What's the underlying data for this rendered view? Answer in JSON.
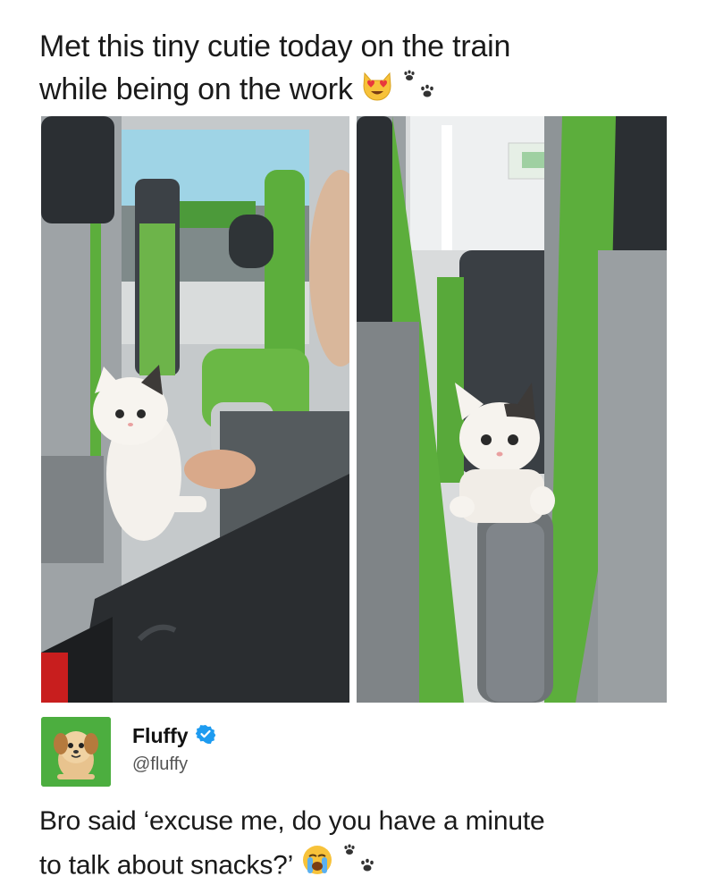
{
  "caption": {
    "line1": "Met this tiny cutie today on the train",
    "line2": "while being on the work",
    "emojis": [
      "heart-eyes-cat-emoji",
      "paw-prints-emoji"
    ]
  },
  "photos": [
    {
      "name": "kitten-on-tray-table-photo"
    },
    {
      "name": "kitten-between-seats-photo"
    }
  ],
  "post": {
    "author_name": "Fluffy",
    "handle": "@fluffy",
    "verified": true,
    "avatar_icon": "puppy-avatar-icon",
    "text_line1": "Bro said ‘excuse me, do you have a minute",
    "text_line2": "to talk about snacks?’",
    "emojis": [
      "crying-face-emoji",
      "paw-prints-emoji"
    ]
  },
  "colors": {
    "seat_green": "#5cae3c",
    "verified_blue": "#1d9bf0",
    "avatar_bg": "#4cae3f",
    "emoji_yellow": "#f7c23a"
  }
}
